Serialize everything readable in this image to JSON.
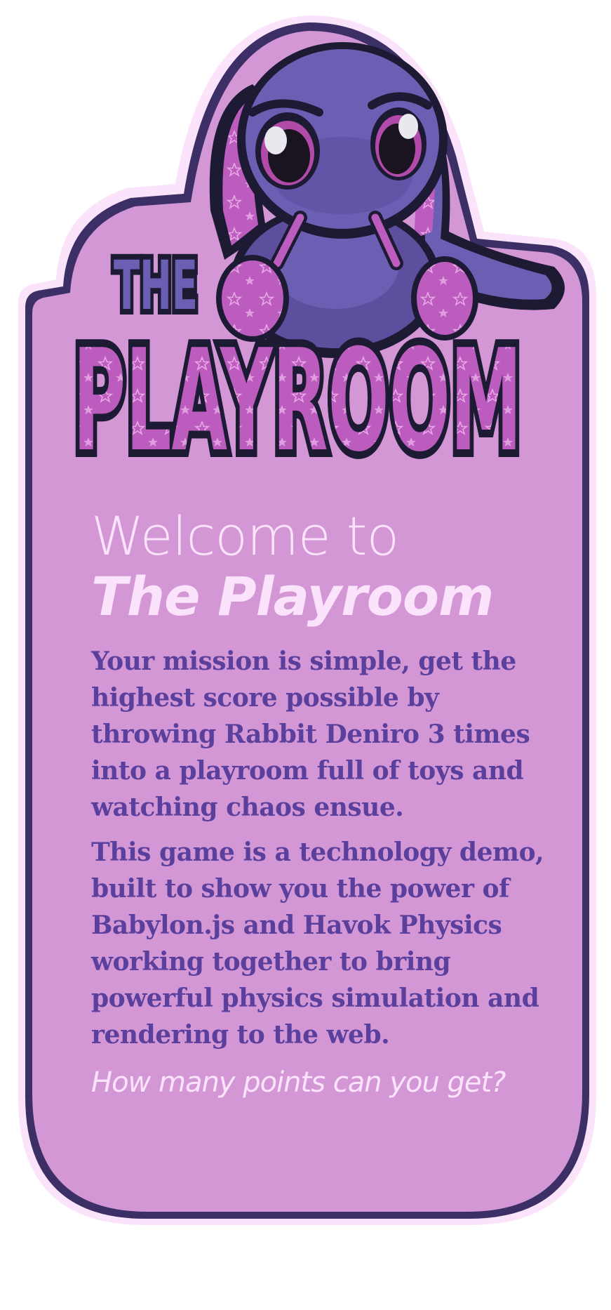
{
  "logo": {
    "word_top": "THE",
    "word_main": "PLAYROOM"
  },
  "welcome": {
    "line1": "Welcome to",
    "title": "The Playroom"
  },
  "body": {
    "paragraph1": "Your mission is simple, get the highest score possible by throwing Rabbit Deniro 3 times into a playroom full of toys and watching chaos ensue.",
    "paragraph2": "This game is a technology demo, built to show you the power of Babylon.js and Havok Physics working together to bring powerful physics simulation and rendering to the web.",
    "question": "How many points can you get?"
  },
  "colors": {
    "panel_fill": "#d497d6",
    "panel_border": "#3c2f66",
    "panel_glow": "#fbe3fb",
    "heading_text": "#fbe3fb",
    "body_text": "#5b3f9c",
    "rabbit_body": "#6a5fb3",
    "logo_pink": "#bd5cbf",
    "logo_outline": "#1d1a33"
  }
}
